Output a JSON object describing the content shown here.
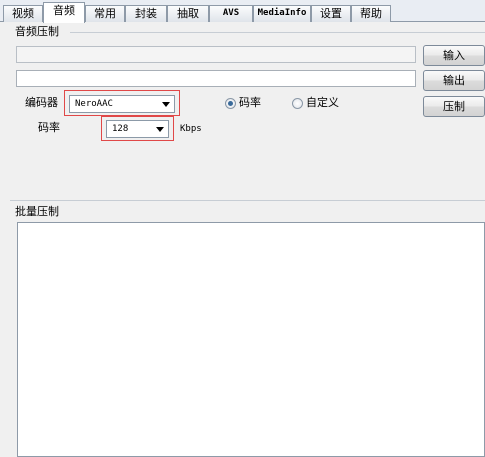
{
  "tabs": [
    {
      "label": "视频"
    },
    {
      "label": "音频"
    },
    {
      "label": "常用"
    },
    {
      "label": "封装"
    },
    {
      "label": "抽取"
    },
    {
      "label": "AVS"
    },
    {
      "label": "MediaInfo"
    },
    {
      "label": "设置"
    },
    {
      "label": "帮助"
    }
  ],
  "active_tab": "音频",
  "audio_compress": {
    "group_title": "音频压制",
    "input_path": "",
    "output_path": "",
    "input_button": "输入",
    "output_button": "输出",
    "compress_button": "压制",
    "encoder_label": "编码器",
    "encoder_value": "NeroAAC",
    "bitrate_label": "码率",
    "bitrate_value": "128",
    "bitrate_unit": "Kbps",
    "radio_bitrate": "码率",
    "radio_custom": "自定义",
    "selected_mode": "码率"
  },
  "batch_compress": {
    "group_title": "批量压制"
  },
  "colors": {
    "highlight_box": "#e04848",
    "panel_bg": "#f0f0f0"
  }
}
